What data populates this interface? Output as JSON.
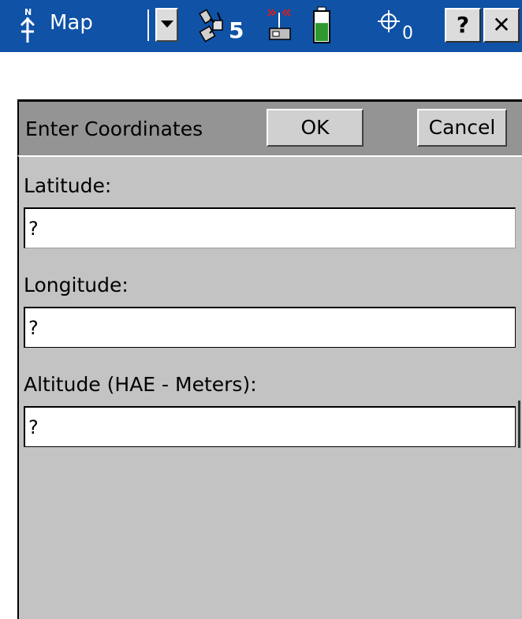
{
  "titlebar": {
    "app_name": "Map",
    "satellite_count": "5",
    "waypoint_count": "0",
    "help_label": "?",
    "close_label": "✕",
    "colors": {
      "background": "#0f52a6",
      "battery_fill": "#2e9a2e",
      "radio_waves": "#d02020"
    },
    "battery_level_fraction": 0.6,
    "icons": [
      "north-arrow-icon",
      "satellite-icon",
      "radio-link-icon",
      "battery-icon",
      "crosshair-icon"
    ]
  },
  "dialog": {
    "title": "Enter Coordinates",
    "ok_label": "OK",
    "cancel_label": "Cancel"
  },
  "form": {
    "latitude": {
      "label": "Latitude:",
      "value": "?"
    },
    "longitude": {
      "label": "Longitude:",
      "value": "?"
    },
    "altitude": {
      "label": "Altitude (HAE - Meters):",
      "value": "?"
    }
  }
}
